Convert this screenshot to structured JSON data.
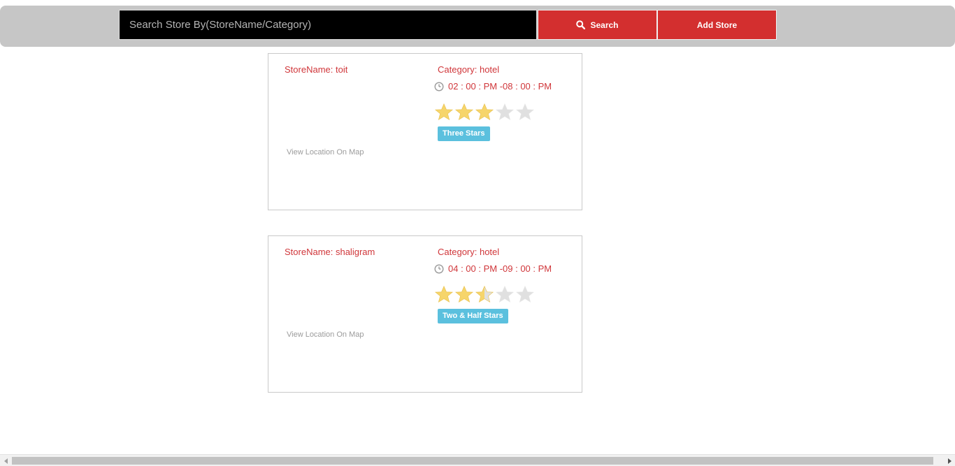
{
  "search": {
    "placeholder": "Search Store By(StoreName/Category)",
    "search_label": "Search",
    "add_label": "Add Store"
  },
  "stores": [
    {
      "name": "StoreName: toit",
      "category": "Category: hotel",
      "time": "02 : 00 : PM -08 : 00 : PM",
      "rating": 3,
      "rating_label": "Three Stars",
      "map_link": "View Location On Map"
    },
    {
      "name": "StoreName: shaligram",
      "category": "Category: hotel",
      "time": "04 : 00 : PM -09 : 00 : PM",
      "rating": 2.5,
      "rating_label": "Two & Half Stars",
      "map_link": "View Location On Map"
    }
  ],
  "colors": {
    "accent": "#d32f2f",
    "text_red": "#d0363a",
    "badge": "#5bc0de",
    "star_on": "#f6d56b",
    "star_off": "#e0e0e0"
  },
  "icons": {
    "search": "search-icon",
    "clock": "clock-icon",
    "star": "star-icon"
  }
}
